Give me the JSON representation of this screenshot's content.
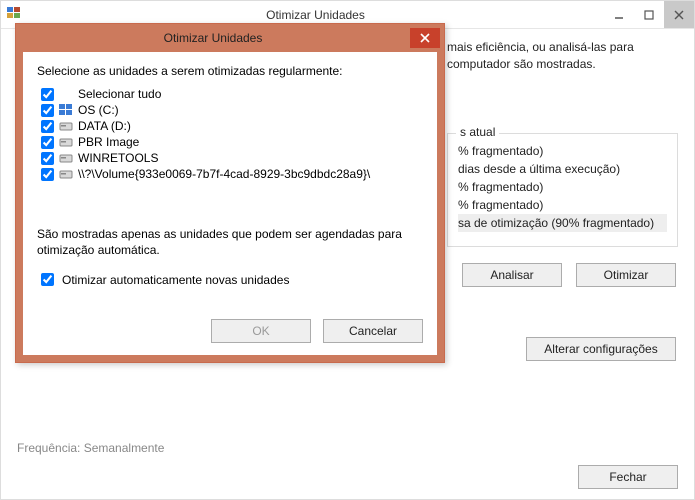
{
  "main": {
    "title": "Otimizar Unidades",
    "intro1": "mais eficiência, ou analisá-las para",
    "intro2": "computador são mostradas.",
    "status_header": "s atual",
    "status_lines": [
      "% fragmentado)",
      " dias desde a última execução)",
      "% fragmentado)",
      "% fragmentado)",
      "sa de otimização (90% fragmentado)"
    ],
    "analyze": "Analisar",
    "optimize": "Otimizar",
    "change_settings": "Alterar configurações",
    "freq_label": "Frequência: Semanalmente",
    "close": "Fechar"
  },
  "modal": {
    "title": "Otimizar Unidades",
    "heading": "Selecione as unidades a serem otimizadas regularmente:",
    "items": [
      {
        "label": "Selecionar tudo",
        "icon": "none"
      },
      {
        "label": "OS (C:)",
        "icon": "win"
      },
      {
        "label": "DATA (D:)",
        "icon": "drive"
      },
      {
        "label": "PBR Image",
        "icon": "drive"
      },
      {
        "label": "WINRETOOLS",
        "icon": "drive"
      },
      {
        "label": "\\\\?\\Volume{933e0069-7b7f-4cad-8929-3bc9dbdc28a9}\\",
        "icon": "drive"
      }
    ],
    "note": "São mostradas apenas as unidades que podem ser agendadas para otimização automática.",
    "auto_new": "Otimizar automaticamente novas unidades",
    "ok": "OK",
    "cancel": "Cancelar"
  }
}
